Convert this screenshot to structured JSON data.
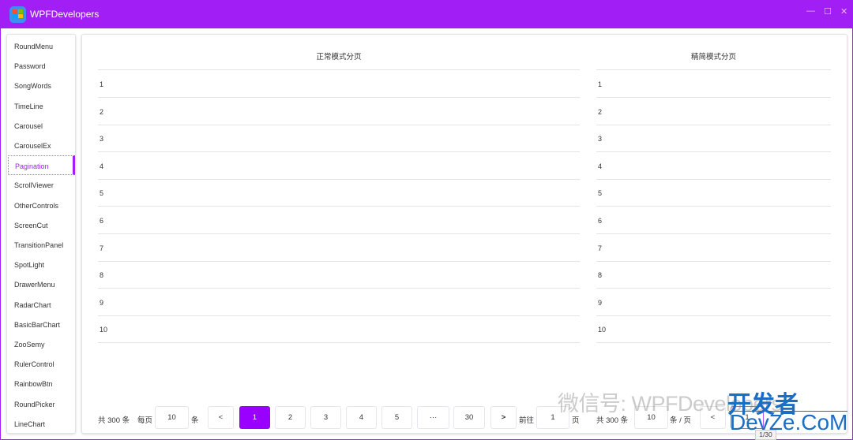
{
  "window": {
    "title": "WPFDevelopers",
    "controls": {
      "minimize": "—",
      "maximize": "☐",
      "close": "✕"
    }
  },
  "sidebar": {
    "items": [
      "RoundMenu",
      "Password",
      "SongWords",
      "TimeLine",
      "Carousel",
      "CarouselEx",
      "Pagination",
      "ScrollViewer",
      "OtherControls",
      "ScreenCut",
      "TransitionPanel",
      "SpotLight",
      "DrawerMenu",
      "RadarChart",
      "BasicBarChart",
      "ZooSemy",
      "RulerControl",
      "RainbowBtn",
      "RoundPicker",
      "LineChart"
    ],
    "selected": "Pagination"
  },
  "normal": {
    "title": "正常模式分页",
    "rows": [
      "1",
      "2",
      "3",
      "4",
      "5",
      "6",
      "7",
      "8",
      "9",
      "10"
    ],
    "pager": {
      "total": "共 300 条",
      "per_page_label": "每页",
      "per_page": "10",
      "unit": "条",
      "prev": "<",
      "pages": [
        "1",
        "2",
        "3",
        "4",
        "5",
        "···",
        "30"
      ],
      "current": "1",
      "next": ">",
      "goto_label": "前往",
      "goto_value": "1",
      "goto_unit": "页"
    }
  },
  "simple": {
    "title": "精简模式分页",
    "rows": [
      "1",
      "2",
      "3",
      "4",
      "5",
      "6",
      "7",
      "8",
      "9",
      "10"
    ],
    "pager": {
      "total": "共 300 条",
      "per_page": "10",
      "unit": "条 / 页",
      "prev": "<",
      "current": "1",
      "tooltip": "1/30"
    }
  },
  "watermark": {
    "line1": "微信号: WPFDevelopers",
    "line2": "开发者",
    "line3": "DevZe.CoM"
  },
  "colors": {
    "accent": "#a11ff5"
  }
}
